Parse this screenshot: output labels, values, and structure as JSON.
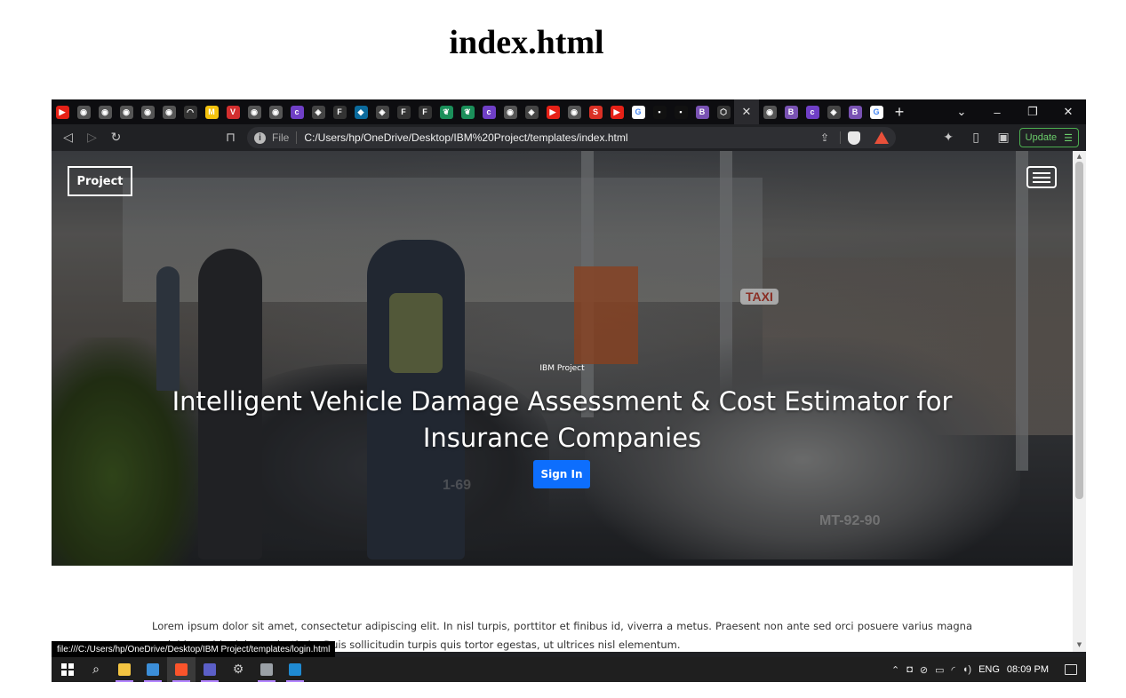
{
  "document_title": "index.html",
  "browser": {
    "tabs": [
      {
        "icon": "youtube-icon",
        "color": "#e62117",
        "glyph": "▶"
      },
      {
        "icon": "globe-icon",
        "color": "#555",
        "glyph": "◉"
      },
      {
        "icon": "globe-icon",
        "color": "#555",
        "glyph": "◉"
      },
      {
        "icon": "globe-icon",
        "color": "#555",
        "glyph": "◉"
      },
      {
        "icon": "globe-icon",
        "color": "#555",
        "glyph": "◉"
      },
      {
        "icon": "globe-icon",
        "color": "#555",
        "glyph": "◉"
      },
      {
        "icon": "github-icon",
        "color": "#333",
        "glyph": "◠"
      },
      {
        "icon": "gmail-icon",
        "color": "#f4c20d",
        "glyph": "M"
      },
      {
        "icon": "vivaldi-icon",
        "color": "#d32f2f",
        "glyph": "V"
      },
      {
        "icon": "globe-icon",
        "color": "#555",
        "glyph": "◉"
      },
      {
        "icon": "globe-icon",
        "color": "#555",
        "glyph": "◉"
      },
      {
        "icon": "coursera-icon",
        "color": "#6f3fc6",
        "glyph": "c"
      },
      {
        "icon": "cube-icon",
        "color": "#444",
        "glyph": "◈"
      },
      {
        "icon": "file-icon",
        "color": "#333",
        "glyph": "F"
      },
      {
        "icon": "code-icon",
        "color": "#0b6a9c",
        "glyph": "◆"
      },
      {
        "icon": "cube-icon",
        "color": "#444",
        "glyph": "◈"
      },
      {
        "icon": "file-icon",
        "color": "#333",
        "glyph": "F"
      },
      {
        "icon": "file-icon",
        "color": "#333",
        "glyph": "F"
      },
      {
        "icon": "leaf-icon",
        "color": "#1b8f5a",
        "glyph": "❦"
      },
      {
        "icon": "leaf-icon",
        "color": "#1b8f5a",
        "glyph": "❦"
      },
      {
        "icon": "coursera-icon",
        "color": "#6f3fc6",
        "glyph": "c"
      },
      {
        "icon": "globe-icon",
        "color": "#555",
        "glyph": "◉"
      },
      {
        "icon": "cube-icon",
        "color": "#444",
        "glyph": "◈"
      },
      {
        "icon": "youtube-icon",
        "color": "#e62117",
        "glyph": "▶"
      },
      {
        "icon": "globe-icon",
        "color": "#555",
        "glyph": "◉"
      },
      {
        "icon": "s-icon",
        "color": "#d93025",
        "glyph": "S"
      },
      {
        "icon": "youtube-icon",
        "color": "#e62117",
        "glyph": "▶"
      },
      {
        "icon": "google-icon",
        "color": "#fff",
        "glyph": "G"
      },
      {
        "icon": "dark-icon",
        "color": "#111",
        "glyph": "▪"
      },
      {
        "icon": "dark-icon",
        "color": "#111",
        "glyph": "▪"
      },
      {
        "icon": "bootstrap-icon",
        "color": "#7952b3",
        "glyph": "B"
      },
      {
        "icon": "box-icon",
        "color": "#333",
        "glyph": "⬡"
      },
      {
        "icon": "globe-icon",
        "color": "#555",
        "glyph": "◉"
      },
      {
        "icon": "bootstrap-icon",
        "color": "#7952b3",
        "glyph": "B"
      },
      {
        "icon": "coursera-icon",
        "color": "#6f3fc6",
        "glyph": "c"
      },
      {
        "icon": "cube-icon",
        "color": "#444",
        "glyph": "◈"
      },
      {
        "icon": "bootstrap-icon",
        "color": "#7952b3",
        "glyph": "B"
      },
      {
        "icon": "google-icon",
        "color": "#fff",
        "glyph": "G"
      }
    ],
    "new_tab": "+",
    "window_controls": {
      "dropdown": "⌄",
      "minimize": "–",
      "restore": "❐",
      "close": "✕"
    },
    "toolbar": {
      "back": "◁",
      "forward": "▷",
      "reload": "↻",
      "bookmark": "⊓"
    },
    "address": {
      "info": "i",
      "scheme": "File",
      "url": "C:/Users/hp/OneDrive/Desktop/IBM%20Project/templates/index.html"
    },
    "right_tools": {
      "extensions": "✦",
      "sidebar": "▯",
      "wallet": "▣"
    },
    "update_button": "Update",
    "update_menu": "☰"
  },
  "page": {
    "brand": "Project",
    "kicker": "IBM Project",
    "headline": "Intelligent Vehicle Damage Assessment & Cost Estimator for Insurance Companies",
    "signin_button": "Sign In",
    "scene_text": {
      "taxi": "TAXI",
      "plate": "MT-92-90",
      "plate2": "1-69"
    },
    "body_text": "Lorem ipsum dolor sit amet, consectetur adipiscing elit. In nisl turpis, porttitor et finibus id, viverra a metus. Praesent non ante sed orci posuere varius magna orci, id gravida dolor molestie in. Duis sollicitudin turpis quis tortor egestas, ut ultrices nisl elementum."
  },
  "status_bar_url": "file:///C:/Users/hp/OneDrive/Desktop/IBM Project/templates/login.html",
  "taskbar": {
    "items": [
      {
        "name": "search-icon",
        "color": "#ffffff",
        "glyph": "⌕"
      },
      {
        "name": "file-explorer-icon",
        "color": "#f4c542"
      },
      {
        "name": "control-panel-icon",
        "color": "#3b8ed8"
      },
      {
        "name": "brave-browser-icon",
        "color": "#fb542b",
        "active": true
      },
      {
        "name": "shield-app-icon",
        "color": "#5b5fc7"
      },
      {
        "name": "settings-icon",
        "color": "#cccccc",
        "glyph": "⚙"
      },
      {
        "name": "network-app-icon",
        "color": "#9aa0a6"
      },
      {
        "name": "vscode-icon",
        "color": "#1f8ad2"
      }
    ],
    "tray": {
      "chevron": "⌃",
      "language": "ENG",
      "time": "08:09 PM"
    }
  }
}
